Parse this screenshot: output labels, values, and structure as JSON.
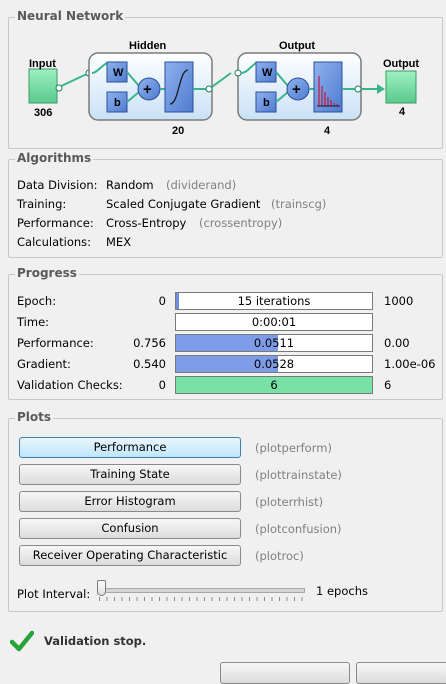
{
  "network": {
    "title": "Neural Network",
    "input_label": "Input",
    "input_size": "306",
    "hidden_label": "Hidden",
    "hidden_size": "20",
    "output_layer_label": "Output",
    "output_layer_size": "4",
    "output_label": "Output",
    "output_size": "4",
    "weight_symbol": "W",
    "bias_symbol": "b",
    "sum_symbol": "+"
  },
  "algorithms": {
    "title": "Algorithms",
    "rows": [
      {
        "label": "Data Division:",
        "value": "Random",
        "fn": "(dividerand)"
      },
      {
        "label": "Training:",
        "value": "Scaled Conjugate Gradient",
        "fn": "(trainscg)"
      },
      {
        "label": "Performance:",
        "value": "Cross-Entropy",
        "fn": "(crossentropy)"
      },
      {
        "label": "Calculations:",
        "value": "MEX",
        "fn": ""
      }
    ]
  },
  "progress": {
    "title": "Progress",
    "rows": [
      {
        "label": "Epoch:",
        "start": "0",
        "current": "15 iterations",
        "end": "1000",
        "fraction": 0.015,
        "fill": "#6e8fe0"
      },
      {
        "label": "Time:",
        "start": "",
        "current": "0:00:01",
        "end": "",
        "fraction": 0,
        "fill": "#6e8fe0"
      },
      {
        "label": "Performance:",
        "start": "0.756",
        "current": "0.0511",
        "end": "0.00",
        "fraction": 0.52,
        "fill": "#7d9be6"
      },
      {
        "label": "Gradient:",
        "start": "0.540",
        "current": "0.0528",
        "end": "1.00e-06",
        "fraction": 0.52,
        "fill": "#7d9be6"
      },
      {
        "label": "Validation Checks:",
        "start": "0",
        "current": "6",
        "end": "6",
        "fraction": 1.0,
        "fill": "#78e2a6"
      }
    ]
  },
  "plots": {
    "title": "Plots",
    "buttons": [
      {
        "label": "Performance",
        "fn": "(plotperform)"
      },
      {
        "label": "Training State",
        "fn": "(plottrainstate)"
      },
      {
        "label": "Error Histogram",
        "fn": "(ploterrhist)"
      },
      {
        "label": "Confusion",
        "fn": "(plotconfusion)"
      },
      {
        "label": "Receiver Operating Characteristic",
        "fn": "(plotroc)"
      }
    ],
    "interval_label": "Plot Interval:",
    "interval_value": "1 epochs",
    "slider_fraction": 0
  },
  "status": {
    "text": "Validation stop."
  },
  "colors": {
    "node": "#7de3a6",
    "box": "#6f95de",
    "panel": "#cbe7ff"
  }
}
